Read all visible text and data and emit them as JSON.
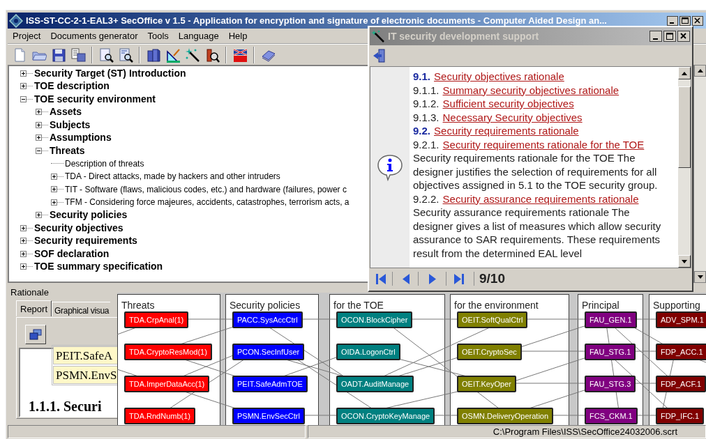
{
  "window": {
    "title": "ISS-ST-CC-2-1-EAL3+ SecOffice v 1.5 - Application for encryption and signature of electronic documents - Computer Aided Design an..."
  },
  "menu": [
    "Project",
    "Documents generator",
    "Tools",
    "Language",
    "Help"
  ],
  "tree": [
    {
      "label": "Security Target (ST) Introduction",
      "expanded": false
    },
    {
      "label": "TOE description",
      "expanded": false
    },
    {
      "label": "TOE security environment",
      "expanded": true,
      "children": [
        {
          "label": "Assets",
          "expanded": false
        },
        {
          "label": "Subjects",
          "expanded": false
        },
        {
          "label": "Assumptions",
          "expanded": false
        },
        {
          "label": "Threats",
          "expanded": true,
          "children": [
            {
              "label": "Description of threats"
            },
            {
              "label": "TDA - Direct attacks, made by hackers and other intruders",
              "expanded": false
            },
            {
              "label": "TIT - Software (flaws, malicious codes, etc.) and hardware (failures, power c",
              "expanded": false
            },
            {
              "label": "TFM - Considering force majeures, accidents, catastrophes, terrorism acts, a",
              "expanded": false
            }
          ]
        },
        {
          "label": "Security policies",
          "expanded": false
        }
      ]
    },
    {
      "label": "Security objectives",
      "expanded": false
    },
    {
      "label": "Security requirements",
      "expanded": false
    },
    {
      "label": "SOF declaration",
      "expanded": false
    },
    {
      "label": "TOE summary specification",
      "expanded": false
    }
  ],
  "help_window": {
    "title": "IT security development support",
    "content": [
      {
        "kind": "heading",
        "number": "9.1.",
        "link": "Security objectives rationale"
      },
      {
        "kind": "subheading",
        "number": "9.1.1.",
        "link": "Summary security objectives rationale"
      },
      {
        "kind": "subheading",
        "number": "9.1.2.",
        "link": "Sufficient security objectives"
      },
      {
        "kind": "subheading",
        "number": "9.1.3.",
        "link": "Necessary Security objectives"
      },
      {
        "kind": "heading",
        "number": "9.2.",
        "link": "Security requirements rationale"
      },
      {
        "kind": "subheading",
        "number": "9.2.1.",
        "link": "Security requirements rationale for the TOE"
      },
      {
        "kind": "paragraph",
        "text": "Security requirements rationale for the TOE The designer justifies the selection of requirements for all objectives assigned in 5.1 to the TOE security group."
      },
      {
        "kind": "subheading",
        "number": "9.2.2.",
        "link": "Security assurance requirements rationale"
      },
      {
        "kind": "paragraph",
        "text": "Security assurance requirements rationale The designer gives a list of measures which allow security assurance to SAR requirements. These requirements result from the determined EAL level"
      }
    ],
    "page": "9/10"
  },
  "rationale": {
    "label": "Rationale",
    "tabs": [
      {
        "label": "Report",
        "selected": true
      },
      {
        "label": "Graphical visua",
        "selected": false
      }
    ],
    "report_cells": [
      "PEIT.SafeA",
      "PSMN.EnvS"
    ],
    "report_heading": "1.1.1. Securi"
  },
  "graph": {
    "columns": [
      {
        "title": "Threats",
        "color": "#ff0000",
        "nodes": [
          "TDA.CrpAnal(1)",
          "TDA.CryptoResMod(1)",
          "TDA.ImperDataAcc(1)",
          "TDA.RndNumb(1)"
        ]
      },
      {
        "title": "Security policies",
        "color": "#0000ff",
        "nodes": [
          "PACC.SysAccCtrl",
          "PCON.SecInfUser",
          "PEIT.SafeAdmTOE",
          "PSMN.EnvSecCtrl"
        ]
      },
      {
        "title": "for the TOE",
        "color": "#008080",
        "nodes": [
          "OCON.BlockCipher",
          "OIDA.LogonCtrl",
          "OADT.AuditManage",
          "OCON.CryptoKeyManage"
        ]
      },
      {
        "title": "for the environment",
        "color": "#808000",
        "nodes": [
          "OEIT.SoftQualCtrl",
          "OEIT.CryptoSec",
          "OEIT.KeyOper",
          "OSMN.DeliveryOperation"
        ]
      },
      {
        "title": "Principal",
        "color": "#800080",
        "nodes": [
          "FAU_GEN.1",
          "FAU_STG.1",
          "FAU_STG.3",
          "FCS_CKM.1"
        ]
      },
      {
        "title": "Supporting",
        "color": "#800000",
        "nodes": [
          "ADV_SPM.1",
          "FDP_ACC.1",
          "FDP_ACF.1",
          "FDP_IFC.1"
        ]
      }
    ]
  },
  "status_bar": {
    "path": "C:\\Program Files\\ISS\\SecOffice24032006.scrt"
  }
}
